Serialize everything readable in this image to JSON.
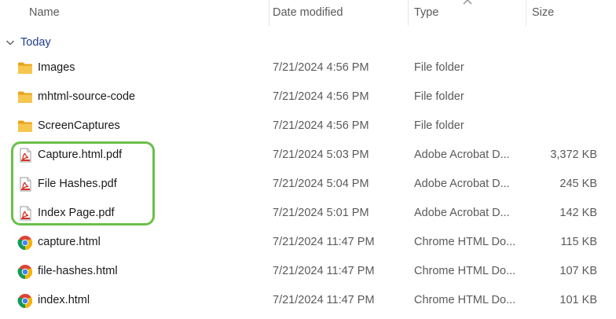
{
  "columns": {
    "name": "Name",
    "date": "Date modified",
    "type": "Type",
    "size": "Size"
  },
  "group": {
    "label": "Today"
  },
  "files": [
    {
      "icon": "folder-icon",
      "name": "Images",
      "date": "7/21/2024 4:56 PM",
      "type": "File folder",
      "size": ""
    },
    {
      "icon": "folder-icon",
      "name": "mhtml-source-code",
      "date": "7/21/2024 4:56 PM",
      "type": "File folder",
      "size": ""
    },
    {
      "icon": "folder-icon",
      "name": "ScreenCaptures",
      "date": "7/21/2024 4:56 PM",
      "type": "File folder",
      "size": ""
    },
    {
      "icon": "pdf-icon",
      "name": "Capture.html.pdf",
      "date": "7/21/2024 5:03 PM",
      "type": "Adobe Acrobat D...",
      "size": "3,372 KB"
    },
    {
      "icon": "pdf-icon",
      "name": "File Hashes.pdf",
      "date": "7/21/2024 5:04 PM",
      "type": "Adobe Acrobat D...",
      "size": "245 KB"
    },
    {
      "icon": "pdf-icon",
      "name": "Index Page.pdf",
      "date": "7/21/2024 5:01 PM",
      "type": "Adobe Acrobat D...",
      "size": "142 KB"
    },
    {
      "icon": "chrome-icon",
      "name": "capture.html",
      "date": "7/21/2024 11:47 PM",
      "type": "Chrome HTML Do...",
      "size": "115 KB"
    },
    {
      "icon": "chrome-icon",
      "name": "file-hashes.html",
      "date": "7/21/2024 11:47 PM",
      "type": "Chrome HTML Do...",
      "size": "107 KB"
    },
    {
      "icon": "chrome-icon",
      "name": "index.html",
      "date": "7/21/2024 11:47 PM",
      "type": "Chrome HTML Do...",
      "size": "101 KB"
    }
  ],
  "colors": {
    "highlight": "#6cbf4a",
    "group_text": "#1f3d8f",
    "folder": "#f4c247",
    "pdf": "#d93025"
  }
}
